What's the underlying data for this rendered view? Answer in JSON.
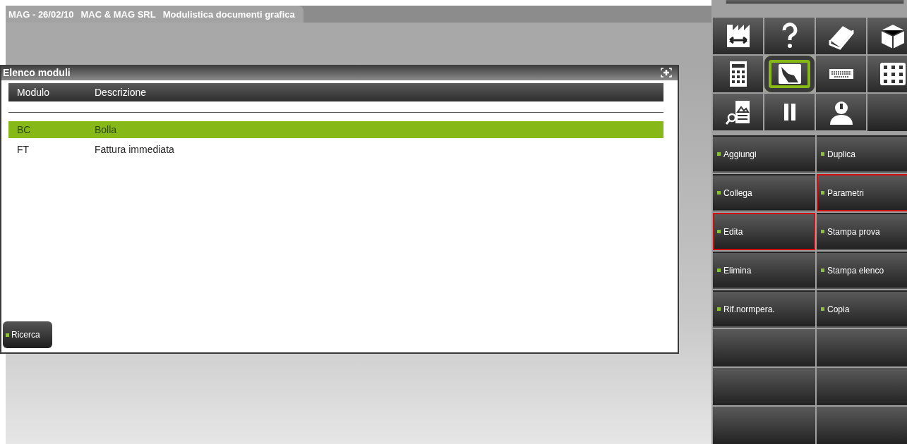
{
  "header": {
    "segments": [
      "MAG - 26/02/10",
      "MAC & MAG SRL",
      "Modulistica documenti grafica"
    ]
  },
  "panel": {
    "title": "Elenco moduli",
    "columns": [
      "Modulo",
      "Descrizione"
    ],
    "rows": [
      {
        "code": "BC",
        "description": "Bolla",
        "selected": true
      },
      {
        "code": "FT",
        "description": "Fattura immediata",
        "selected": false
      }
    ],
    "search_button": "Ricerca"
  },
  "tools": [
    {
      "kind": "factory",
      "selected": false
    },
    {
      "kind": "help",
      "selected": false
    },
    {
      "kind": "manual",
      "selected": false
    },
    {
      "kind": "fkey",
      "selected": false
    },
    {
      "kind": "calculator",
      "selected": false
    },
    {
      "kind": "touch",
      "selected": true
    },
    {
      "kind": "keyboard",
      "selected": false
    },
    {
      "kind": "grid",
      "selected": false
    },
    {
      "kind": "preview",
      "selected": false
    },
    {
      "kind": "pause",
      "selected": false
    },
    {
      "kind": "user",
      "selected": false
    },
    {
      "kind": "blank"
    }
  ],
  "actions": [
    {
      "kind": "action",
      "label": "Aggiungi",
      "highlighted": false
    },
    {
      "kind": "action",
      "label": "Duplica",
      "highlighted": false
    },
    {
      "kind": "action",
      "label": "Collega",
      "highlighted": false
    },
    {
      "kind": "action",
      "label": "Parametri",
      "highlighted": true
    },
    {
      "kind": "action",
      "label": "Edita",
      "highlighted": true
    },
    {
      "kind": "action",
      "label": "Stampa prova",
      "highlighted": false
    },
    {
      "kind": "action",
      "label": "Elimina",
      "highlighted": false
    },
    {
      "kind": "action",
      "label": "Stampa elenco",
      "highlighted": false
    },
    {
      "kind": "action",
      "label": "Rif.normpera.",
      "highlighted": false
    },
    {
      "kind": "action",
      "label": "Copia",
      "highlighted": false
    },
    {
      "kind": "blank"
    },
    {
      "kind": "blank"
    },
    {
      "kind": "blank"
    },
    {
      "kind": "blank"
    },
    {
      "kind": "blank"
    },
    {
      "kind": "blank"
    }
  ]
}
